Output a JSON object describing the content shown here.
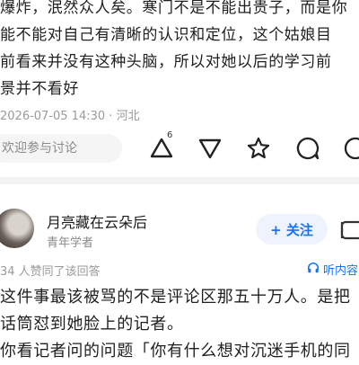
{
  "answer1": {
    "lines": [
      "爆炸，泯然众人矣。寒门不是不能出贵子，而是你",
      "能不能对自己有清晰的认识和定位，这个姑娘目",
      "前看来并没有这种头脑，所以对她以后的学习前",
      "景并不看好"
    ],
    "timestamp": "2026-07-05 14:30",
    "location": "河北"
  },
  "actions": {
    "discuss_placeholder": "欢迎参与讨论",
    "vote_count": "6"
  },
  "answer2": {
    "username": "月亮藏在云朵后",
    "user_title": "青年学者",
    "follow_label": "+ 关注",
    "agree_text": "34 人赞同了该回答",
    "listen_label": "听内容",
    "lines": [
      "这件事最该被骂的不是评论区那五十万人。是把",
      "话筒怼到她脸上的记者。",
      "你看记者问的问题「你有什么想对沉迷手机的同"
    ]
  },
  "colors": {
    "accent": "#1772f6",
    "meta_text": "#9a9a9a",
    "divider": "#f2f3f5"
  }
}
